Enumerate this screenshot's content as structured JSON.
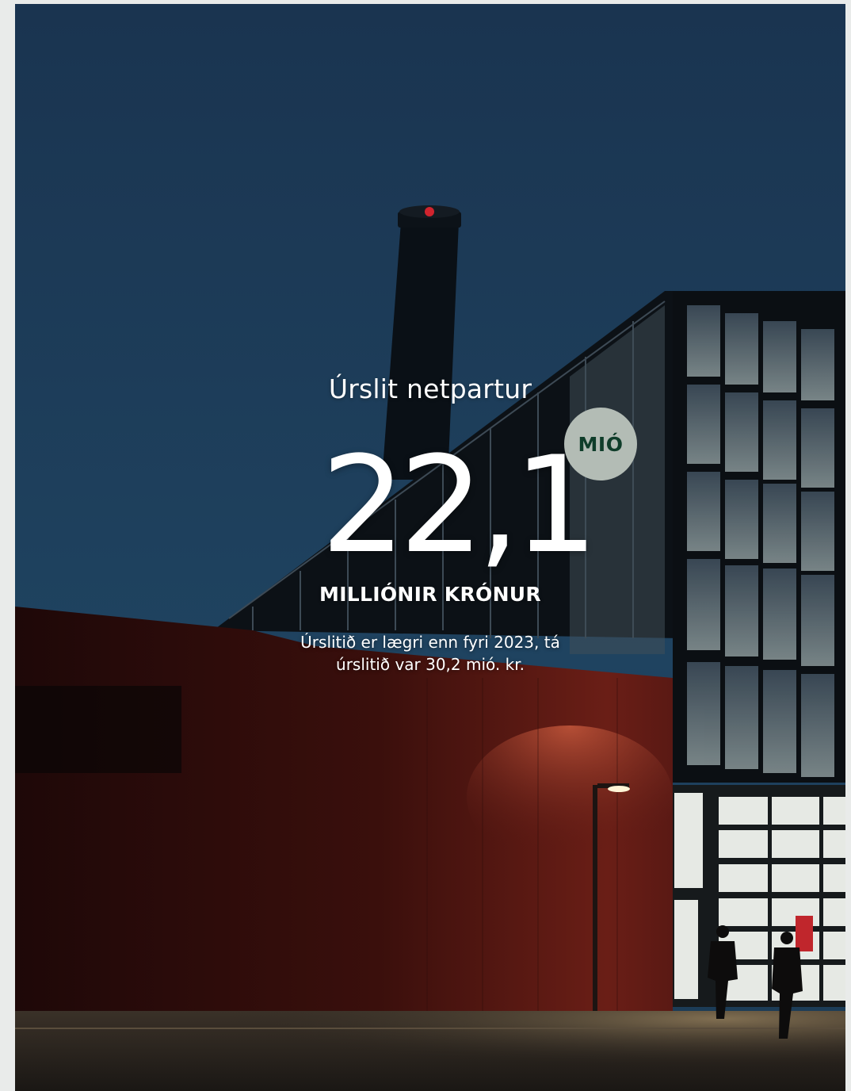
{
  "result": {
    "title": "Úrslit netpartur",
    "value": "22,1",
    "badge": "MIÓ",
    "unit": "MILLIÓNIR KRÓNUR",
    "note_line1": "Úrslitið er lægri enn fyri 2023, tá",
    "note_line2": "úrslitið var 30,2 mió. kr."
  },
  "colors": {
    "sky": "#1b3b58",
    "wall": "#4a1512",
    "badge_bg": "#b3bcb5",
    "badge_text": "#0f3d2a"
  },
  "icons": [
    "street-lamp-icon",
    "person-walking-icon"
  ]
}
